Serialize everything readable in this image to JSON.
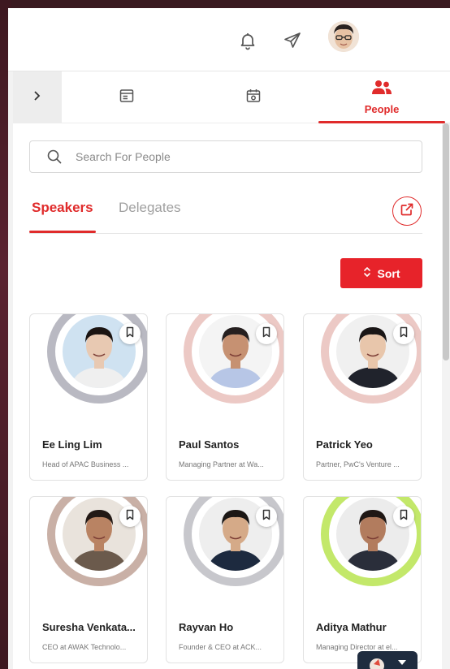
{
  "header": {
    "icons": [
      "bell-icon",
      "send-icon",
      "user-avatar"
    ]
  },
  "tabs": {
    "items": [
      {
        "name": "info",
        "icon": "window-icon"
      },
      {
        "name": "agenda",
        "icon": "calendar-icon"
      },
      {
        "name": "people",
        "icon": "people-icon",
        "label": "People",
        "active": true
      }
    ]
  },
  "search": {
    "placeholder": "Search For People"
  },
  "subtabs": {
    "speakers": "Speakers",
    "delegates": "Delegates"
  },
  "sort": {
    "label": "Sort"
  },
  "people": [
    {
      "name": "Ee Ling Lim",
      "role": "Head of APAC Business ...",
      "ring": "#b9b9c2",
      "skin": "#e8c9b2",
      "hair": "#1b1412",
      "shirt": "#efefef",
      "bg": "#cfe2f1"
    },
    {
      "name": "Paul Santos",
      "role": "Managing Partner at Wa...",
      "ring": "#ecc9c5",
      "skin": "#c69172",
      "hair": "#262020",
      "shirt": "#b7c6e6",
      "bg": "#f4f4f4"
    },
    {
      "name": "Patrick Yeo",
      "role": "Partner, PwC's Venture ...",
      "ring": "#ecc9c5",
      "skin": "#e8c6ab",
      "hair": "#1a1616",
      "shirt": "#20232c",
      "bg": "#f0f0f0"
    },
    {
      "name": "Suresha Venkata...",
      "role": "CEO at AWAK Technolo...",
      "ring": "#c9b0a6",
      "skin": "#b98363",
      "hair": "#231915",
      "shirt": "#6b5a4c",
      "bg": "#e9e3dc"
    },
    {
      "name": "Rayvan Ho",
      "role": "Founder & CEO at ACK...",
      "ring": "#c7c7cc",
      "skin": "#d5aa88",
      "hair": "#1b1715",
      "shirt": "#1d2a3f",
      "bg": "#eeeeee"
    },
    {
      "name": "Aditya Mathur",
      "role": "Managing Director at el...",
      "ring": "#c3e86a",
      "skin": "#b27c5e",
      "hair": "#1f1714",
      "shirt": "#2a2e3a",
      "bg": "#ececec"
    }
  ]
}
